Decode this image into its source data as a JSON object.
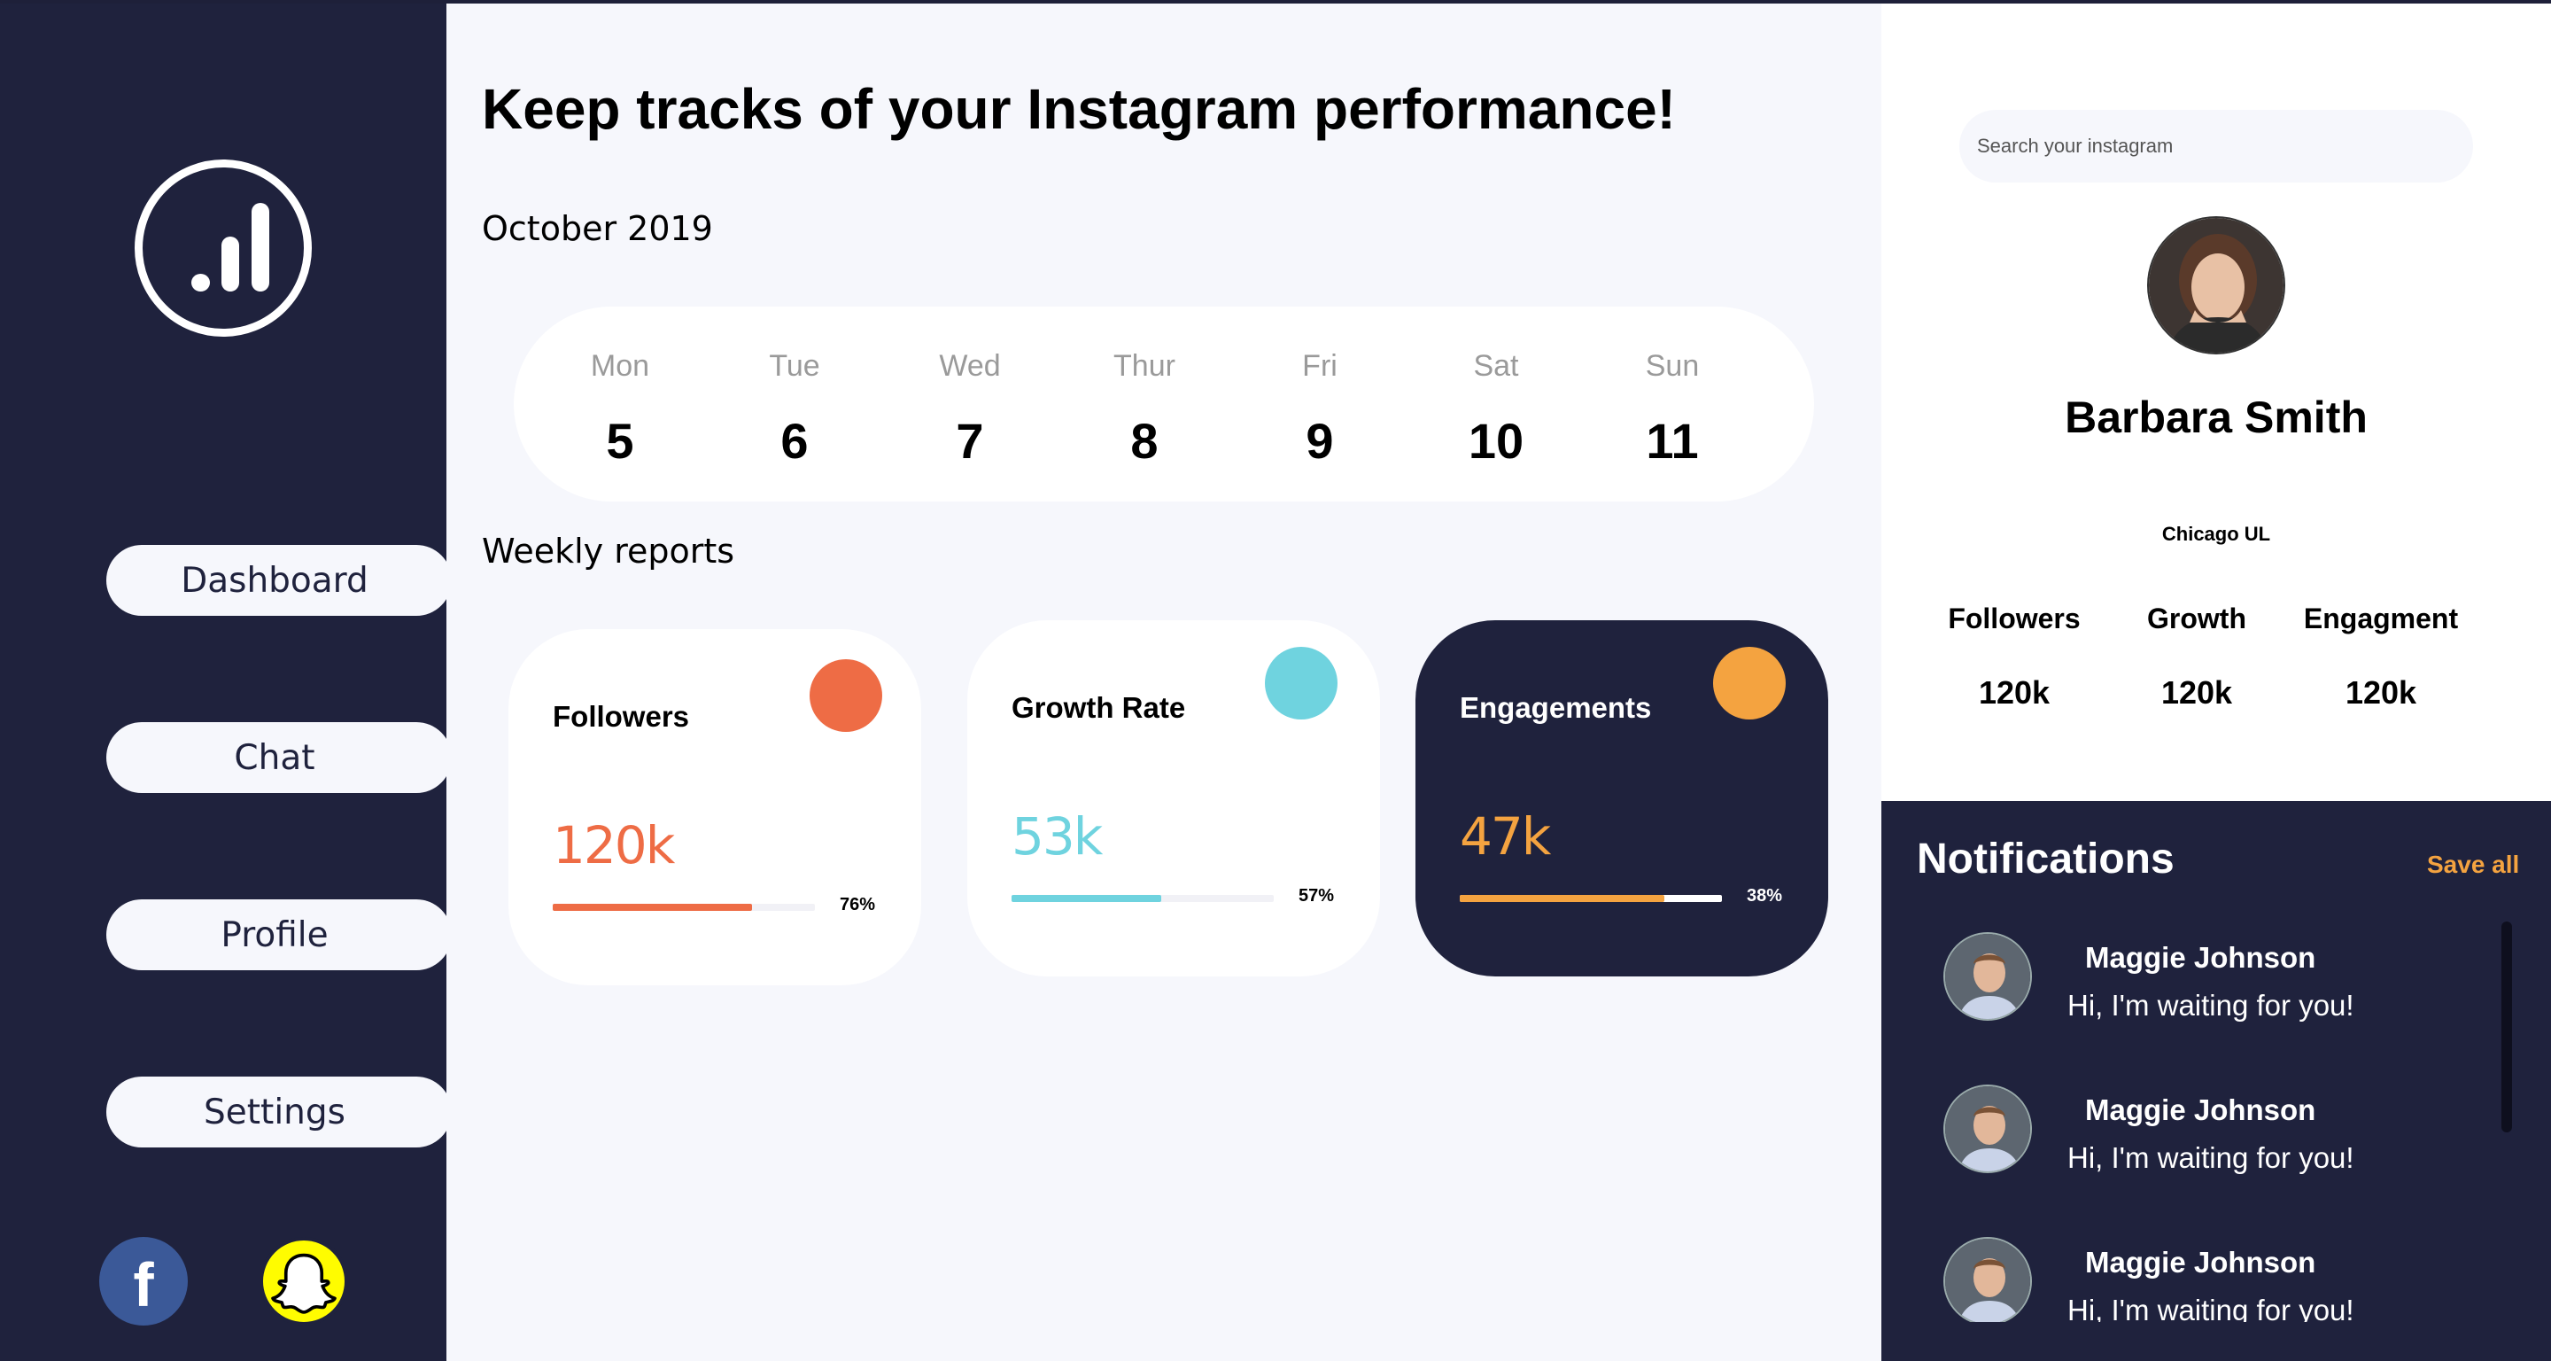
{
  "sidebar": {
    "nav": [
      {
        "label": "Dashboard"
      },
      {
        "label": "Chat"
      },
      {
        "label": "Profile"
      },
      {
        "label": "Settings"
      }
    ],
    "social": {
      "facebook_glyph": "f"
    }
  },
  "main": {
    "headline": "Keep tracks of your Instagram performance!",
    "month": "October 2019",
    "days": [
      {
        "name": "Mon",
        "date": "5"
      },
      {
        "name": "Tue",
        "date": "6"
      },
      {
        "name": "Wed",
        "date": "7"
      },
      {
        "name": "Thur",
        "date": "8"
      },
      {
        "name": "Fri",
        "date": "9"
      },
      {
        "name": "Sat",
        "date": "10"
      },
      {
        "name": "Sun",
        "date": "11"
      }
    ],
    "weekly_title": "Weekly reports",
    "cards": [
      {
        "title": "Followers",
        "value": "120k",
        "percent": "76%",
        "progress": 0.76,
        "accent": "#ee6c45",
        "theme": "light"
      },
      {
        "title": "Growth Rate",
        "value": "53k",
        "percent": "57%",
        "progress": 0.57,
        "accent": "#6fd3df",
        "theme": "light"
      },
      {
        "title": "Engagements",
        "value": "47k",
        "percent": "38%",
        "progress": 0.78,
        "accent": "#f4a340",
        "theme": "dark"
      }
    ]
  },
  "profile": {
    "search_placeholder": "Search your instagram",
    "name": "Barbara Smith",
    "location": "Chicago UL",
    "stats": [
      {
        "label": "Followers",
        "value": "120k"
      },
      {
        "label": "Growth",
        "value": "120k"
      },
      {
        "label": "Engagment",
        "value": "120k"
      }
    ]
  },
  "notifications": {
    "title": "Notifications",
    "save_all": "Save all",
    "items": [
      {
        "name": "Maggie Johnson",
        "message": "Hi, I'm waiting for you!"
      },
      {
        "name": "Maggie Johnson",
        "message": "Hi, I'm waiting for you!"
      },
      {
        "name": "Maggie Johnson",
        "message": "Hi, I'm waiting for you!"
      }
    ]
  },
  "colors": {
    "sidebar_bg": "#1f223d",
    "page_bg": "#f6f7fc",
    "orange": "#ee6c45",
    "teal": "#6fd3df",
    "amber": "#f4a340"
  },
  "icons": [
    "analytics-logo-icon",
    "facebook-icon",
    "snapchat-icon"
  ]
}
